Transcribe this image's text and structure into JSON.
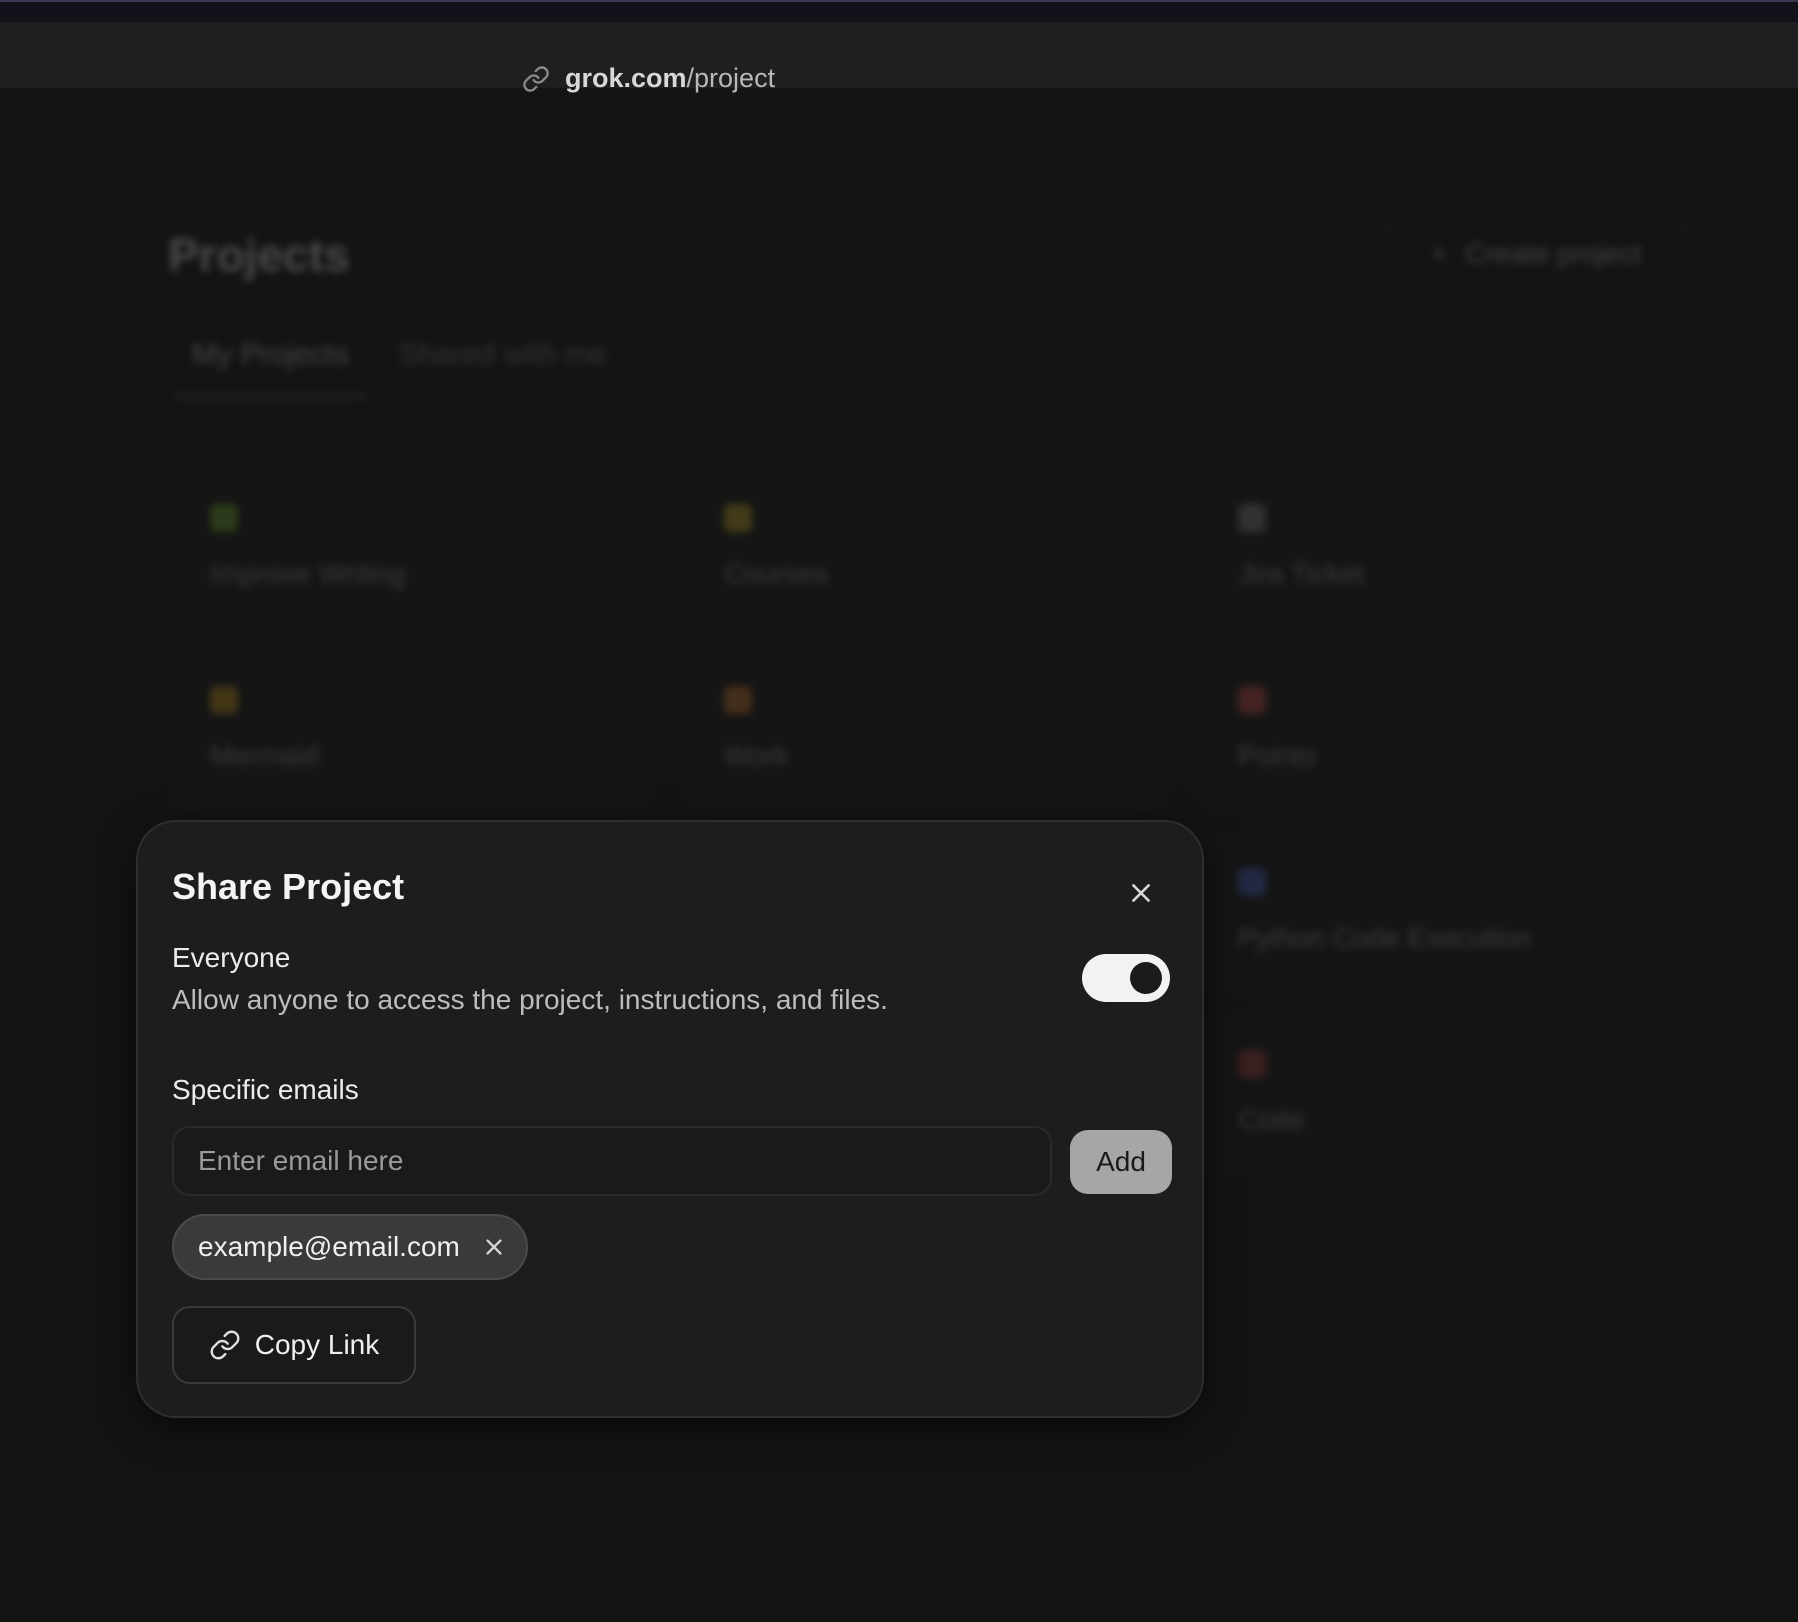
{
  "browser": {
    "url_domain": "grok.com",
    "url_path": "/project",
    "link_icon": "link-icon"
  },
  "background": {
    "title": "Projects",
    "create_button_label": "Create project",
    "tabs": [
      {
        "label": "My Projects",
        "active": true
      },
      {
        "label": "Shared with me",
        "active": false
      }
    ],
    "cards": [
      {
        "label": "Improve Writing",
        "icon": "sparkle-icon",
        "icon_color": "#3f5a1f"
      },
      {
        "label": "Courses",
        "icon": "triangle-icon",
        "icon_color": "#6a5a1e"
      },
      {
        "label": "Jira Ticket",
        "icon": "calendar-icon",
        "icon_color": "#4a4a4a"
      },
      {
        "label": "Mermaid",
        "icon": "square-icon",
        "icon_color": "#6a5218"
      },
      {
        "label": "Work",
        "icon": "briefcase-icon",
        "icon_color": "#6a4422"
      },
      {
        "label": "Points",
        "icon": "tag-icon",
        "icon_color": "#6a2e2e"
      },
      {
        "label": "Python Code Execution",
        "icon": "phone-icon",
        "icon_color": "#2e3a6a"
      },
      {
        "label": "Code",
        "icon": "box-icon",
        "icon_color": "#5a2a2a"
      }
    ]
  },
  "modal": {
    "title": "Share Project",
    "close_icon": "close-icon",
    "everyone_label": "Everyone",
    "everyone_description": "Allow anyone to access the project, instructions, and files.",
    "everyone_enabled": true,
    "specific_emails_label": "Specific emails",
    "email_placeholder": "Enter email here",
    "email_value": "",
    "add_label": "Add",
    "emails": [
      "example@email.com"
    ],
    "copy_link_label": "Copy Link"
  }
}
